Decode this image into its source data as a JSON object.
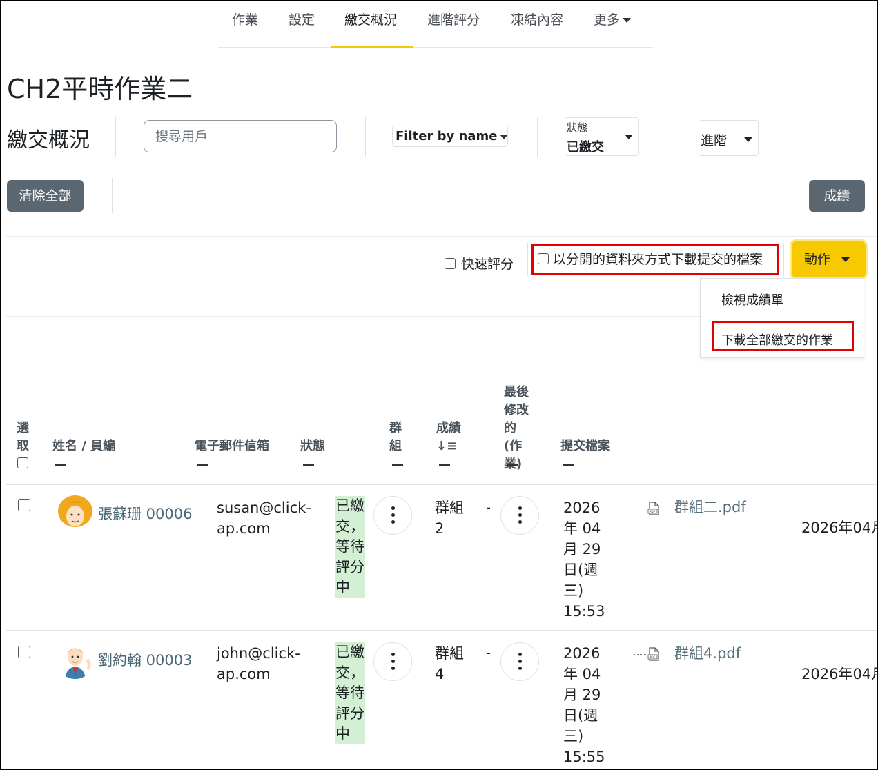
{
  "nav": {
    "items": [
      "作業",
      "設定",
      "繳交概況",
      "進階評分",
      "凍結內容",
      "更多"
    ],
    "active": "繳交概況"
  },
  "page": {
    "title": "CH2平時作業二",
    "section": "繳交概況"
  },
  "filters": {
    "search_placeholder": "搜尋用戶",
    "filter_by_name": "Filter by name",
    "status_label": "狀態",
    "status_value": "已繳交",
    "advanced_value": "進階"
  },
  "buttons": {
    "clear_all": "清除全部",
    "grades": "成績",
    "action": "動作"
  },
  "options": {
    "quick_grading": "快速評分",
    "download_folders": "以分開的資料夾方式下載提交的檔案"
  },
  "dropdown": {
    "items": [
      "檢視成績單",
      "下載全部繳交的作業"
    ]
  },
  "table": {
    "headers": {
      "select": "選取",
      "name": "姓名 / 員編",
      "email": "電子郵件信箱",
      "status": "狀態",
      "group": "群組",
      "grade": "成績",
      "grade_sort": "↓≡",
      "last_modified": "最後修改的(作業)",
      "files": "提交檔案"
    },
    "rows": [
      {
        "name": "張蘇珊 00006",
        "email_1": "susan@click-",
        "email_2": "ap.com",
        "status": "已繳交，等待評分中",
        "group": "群組2",
        "grade": "-",
        "modified": [
          "2026",
          "年 04",
          "月 29",
          "日(週",
          "三)",
          "15:53"
        ],
        "file": "群組二.pdf",
        "extra": "2026年04月"
      },
      {
        "name": "劉約翰 00003",
        "email_1": "john@click-",
        "email_2": "ap.com",
        "status": "已繳交，等待評分中",
        "group": "群組4",
        "grade": "-",
        "modified": [
          "2026",
          "年 04",
          "月 29",
          "日(週",
          "三)",
          "15:55"
        ],
        "file": "群組4.pdf",
        "extra": "2026年04月"
      }
    ]
  },
  "colors": {
    "accent_yellow": "#f7c900",
    "dark_button": "#5b6770",
    "highlight_red": "#e30000",
    "status_green": "#d4f0d4"
  }
}
